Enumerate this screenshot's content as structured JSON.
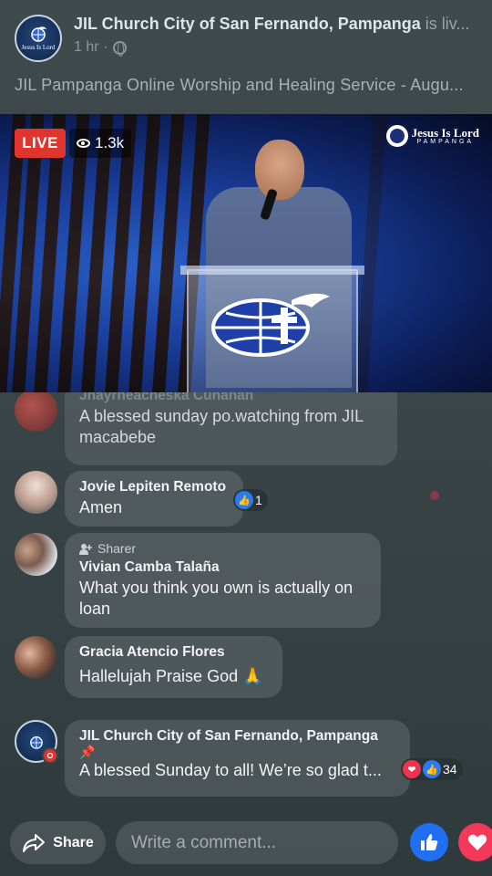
{
  "header": {
    "page_name": "JIL Church City of San Fernando, Pampanga",
    "live_suffix": "is liv...",
    "time": "1 hr",
    "dot": "·",
    "video_title": "JIL Pampanga Online Worship and Healing Service - Augu..."
  },
  "video": {
    "live_label": "LIVE",
    "viewer_count": "1.3k",
    "brand_line1": "Jesus Is Lord",
    "brand_line2": "PAMPANGA"
  },
  "comments": [
    {
      "name": "Jhayrheacheska Cunanan",
      "text": "A blessed sunday po.watching  from JIL macabebe"
    },
    {
      "name": "Jovie Lepiten Remoto",
      "text": "Amen",
      "reaction_count": "1"
    },
    {
      "sharer_label": "Sharer",
      "name": "Vivian Camba Talaña",
      "text": "What you think you own is actually on loan"
    },
    {
      "name": "Gracia Atencio Flores",
      "text": "Hallelujah Praise God 🙏"
    },
    {
      "name": "JIL Church City of San Fernando, Pampanga",
      "pin": "📌",
      "text": "A blessed Sunday to all! We’re so glad t...",
      "reaction_count": "34"
    }
  ],
  "bottom": {
    "share_label": "Share",
    "comment_placeholder": "Write a comment..."
  },
  "colors": {
    "live_red": "#e0352e",
    "like_blue": "#1f6ff0",
    "love_red": "#f3395a"
  }
}
